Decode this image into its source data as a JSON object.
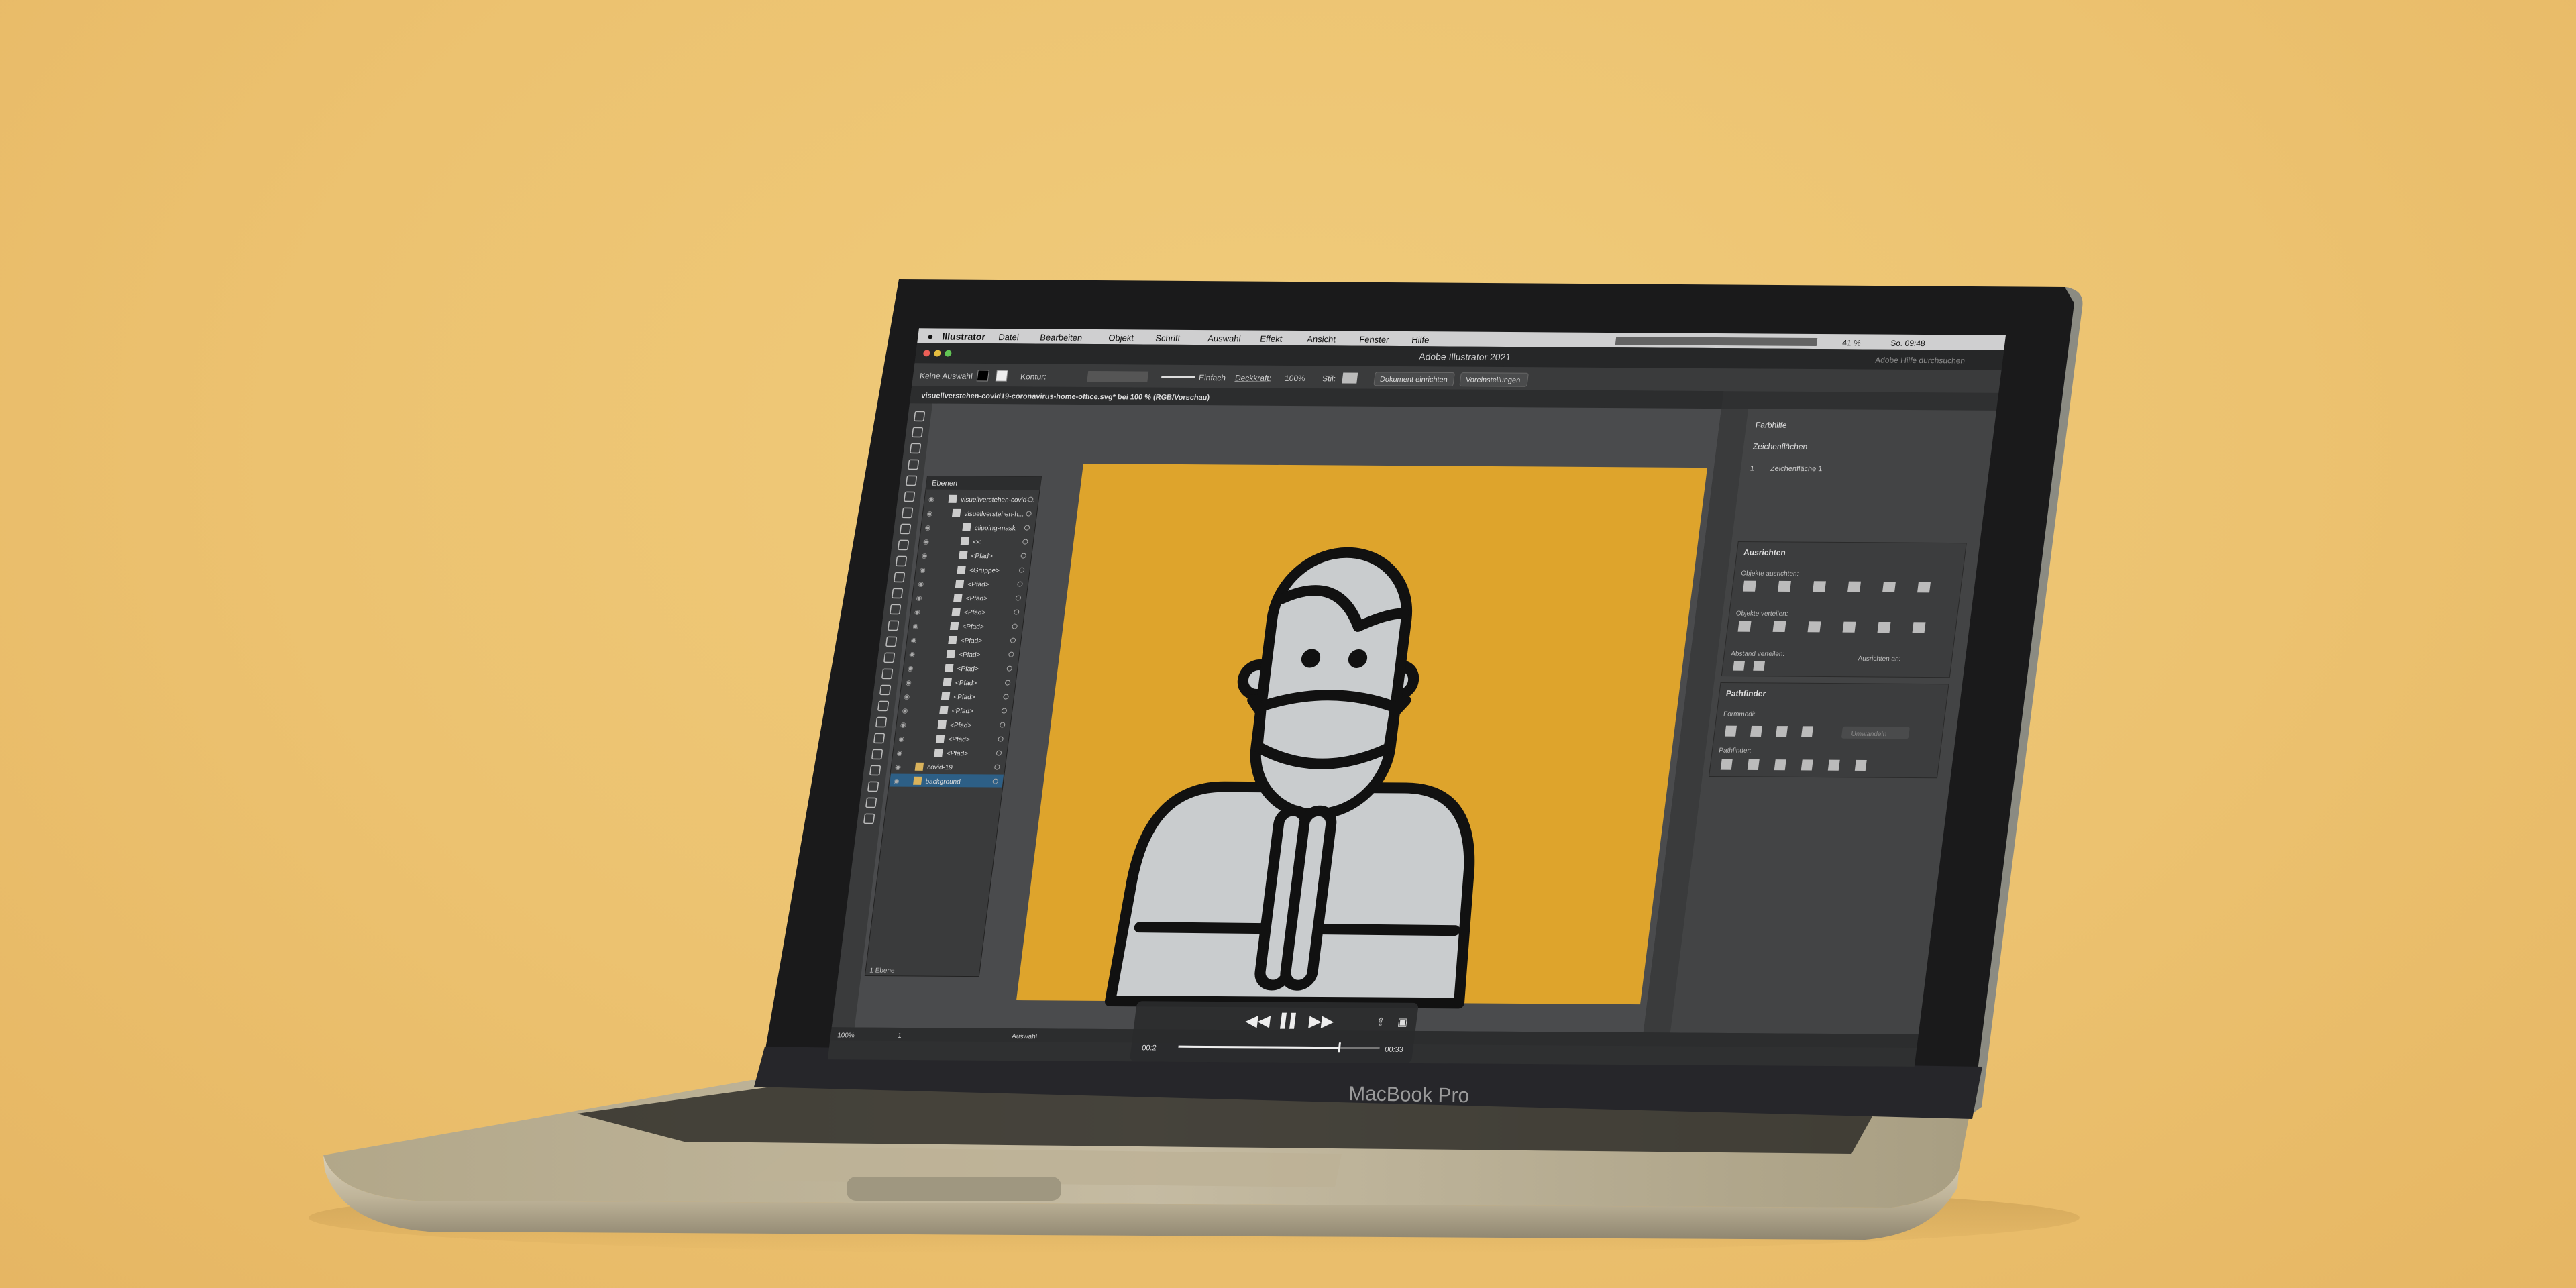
{
  "scene": {
    "background_color": "#ecc270",
    "laptop_brand": "MacBook Pro"
  },
  "menubar": {
    "app": "Illustrator",
    "items": [
      "Datei",
      "Bearbeiten",
      "Objekt",
      "Schrift",
      "Auswahl",
      "Effekt",
      "Ansicht",
      "Fenster",
      "Hilfe"
    ],
    "battery": "41 %",
    "clock": "So. 09:48"
  },
  "window": {
    "title": "Adobe Illustrator 2021",
    "search_placeholder": "Adobe Hilfe durchsuchen",
    "document_tab": "visuellverstehen-covid19-coronavirus-home-office.svg* bei 100 % (RGB/Vorschau)"
  },
  "control_bar": {
    "selection": "Keine Auswahl",
    "stroke_label": "Kontur:",
    "brush": "Einfach",
    "opacity_label": "Deckkraft:",
    "opacity_value": "100%",
    "style_label": "Stil:",
    "doc_setup_button": "Dokument einrichten",
    "preferences_button": "Voreinstellungen"
  },
  "layers_panel": {
    "title": "Ebenen",
    "rows": [
      "visuellverstehen-covid-...",
      "visuellverstehen-h...",
      "clipping-mask",
      "<<",
      "<Pfad>",
      "<Gruppe>",
      "<Pfad>",
      "<Pfad>",
      "<Pfad>",
      "<Pfad>",
      "<Pfad>",
      "<Pfad>",
      "<Pfad>",
      "<Pfad>",
      "<Pfad>",
      "<Pfad>",
      "<Pfad>",
      "<Pfad>",
      "<Pfad>",
      "covid-19",
      "background"
    ],
    "footer": "1 Ebene"
  },
  "right_panels": {
    "tab_color_guide": "Farbhilfe",
    "tab_artboards": "Zeichenflächen",
    "artboard_index": "1",
    "artboard_name": "Zeichenfläche 1",
    "align_title": "Ausrichten",
    "align_objects_label": "Objekte ausrichten:",
    "distribute_label": "Objekte verteilen:",
    "spacing_label": "Abstand verteilen:",
    "align_to_label": "Ausrichten an:",
    "pathfinder_title": "Pathfinder",
    "shape_modes_label": "Formmodi:",
    "pathfinder_label": "Pathfinder:",
    "expand_button": "Umwandeln"
  },
  "status_bar": {
    "zoom": "100%",
    "page": "1",
    "tool": "Auswahl"
  },
  "video_overlay": {
    "time_current": "00:2",
    "time_total": "00:33",
    "progress": 0.8
  },
  "colors": {
    "artboard_yellow": "#dea42c",
    "figure_fill": "#c9ccce",
    "figure_stroke": "#111111",
    "ui_dark": "#3a3b3c",
    "ui_panel": "#434445"
  }
}
